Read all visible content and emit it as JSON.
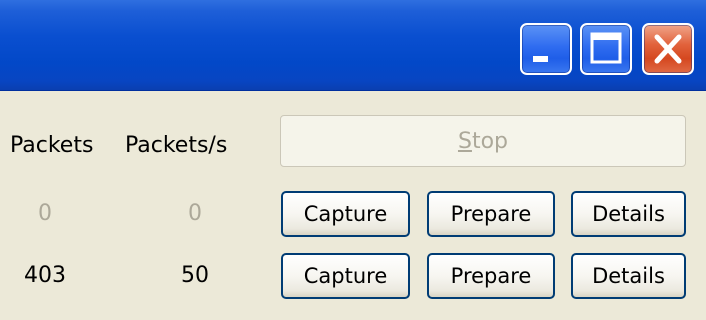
{
  "window": {
    "controls": {
      "minimize": "minimize-icon",
      "maximize": "maximize-icon",
      "close": "close-icon"
    },
    "colors": {
      "titlebar": "#0a4fd0",
      "panel": "#ece9d8",
      "button_border": "#003c74",
      "close_button": "#e2633d",
      "disabled_text": "#aca899"
    }
  },
  "table": {
    "headers": {
      "packets": "Packets",
      "packets_per_sec": "Packets/s"
    },
    "stop_button": {
      "label": "Stop",
      "mnemonic": "S",
      "rest": "top",
      "enabled": false
    },
    "rows": [
      {
        "packets": "0",
        "packets_per_sec": "0",
        "capture_label": "Capture",
        "prepare_label": "Prepare",
        "details_label": "Details"
      },
      {
        "packets": "403",
        "packets_per_sec": "50",
        "capture_label": "Capture",
        "prepare_label": "Prepare",
        "details_label": "Details"
      }
    ]
  }
}
